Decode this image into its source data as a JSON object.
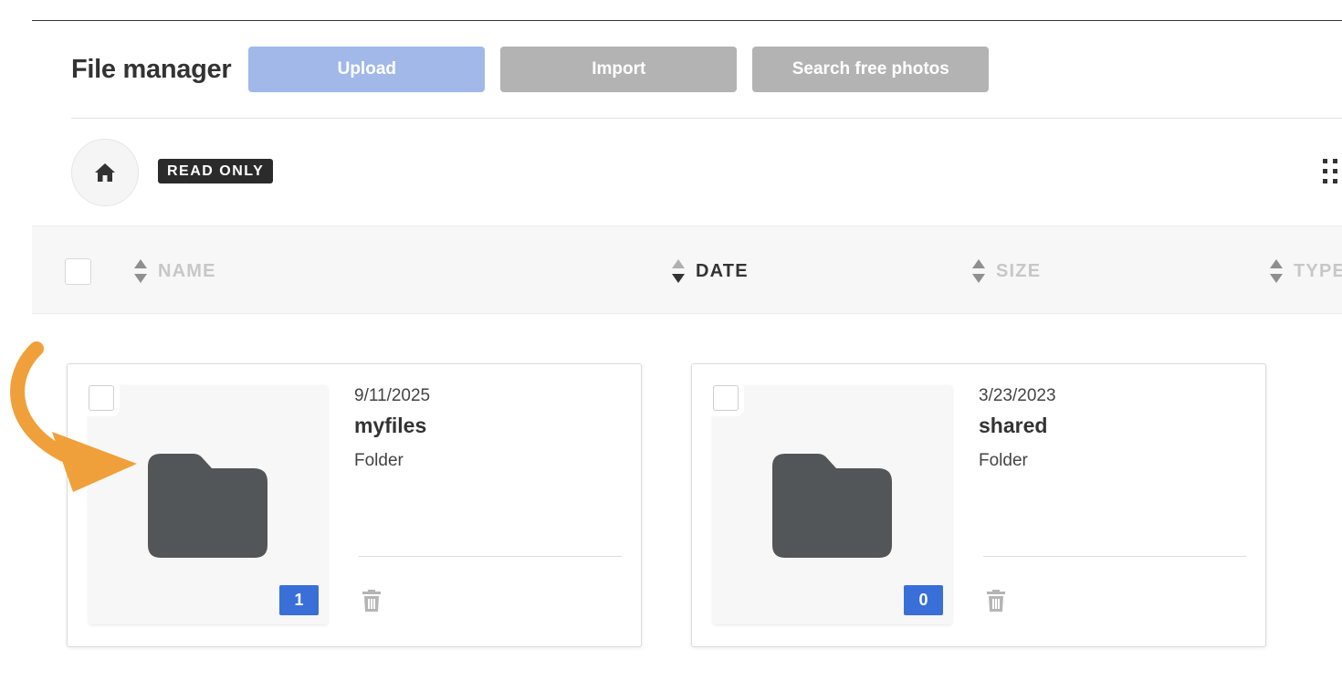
{
  "header": {
    "title": "File manager",
    "buttons": {
      "upload": "Upload",
      "import": "Import",
      "search_photos": "Search free photos"
    }
  },
  "toolbar": {
    "home_icon": "home-icon",
    "badge": "READ ONLY",
    "view_toggle_icon": "grid-dots-icon"
  },
  "table_header": {
    "columns": [
      {
        "label": "NAME",
        "active": false
      },
      {
        "label": "DATE",
        "active": true
      },
      {
        "label": "SIZE",
        "active": false
      },
      {
        "label": "TYPE",
        "active": false
      }
    ]
  },
  "items": [
    {
      "date": "9/11/2025",
      "name": "myfiles",
      "type": "Folder",
      "count": "1"
    },
    {
      "date": "3/23/2023",
      "name": "shared",
      "type": "Folder",
      "count": "0"
    }
  ],
  "colors": {
    "upload_button": "#a1b8e8",
    "disabled_button": "#b3b3b3",
    "count_badge": "#3a6fd8",
    "folder": "#525658",
    "annotation_arrow": "#f0a03a"
  }
}
